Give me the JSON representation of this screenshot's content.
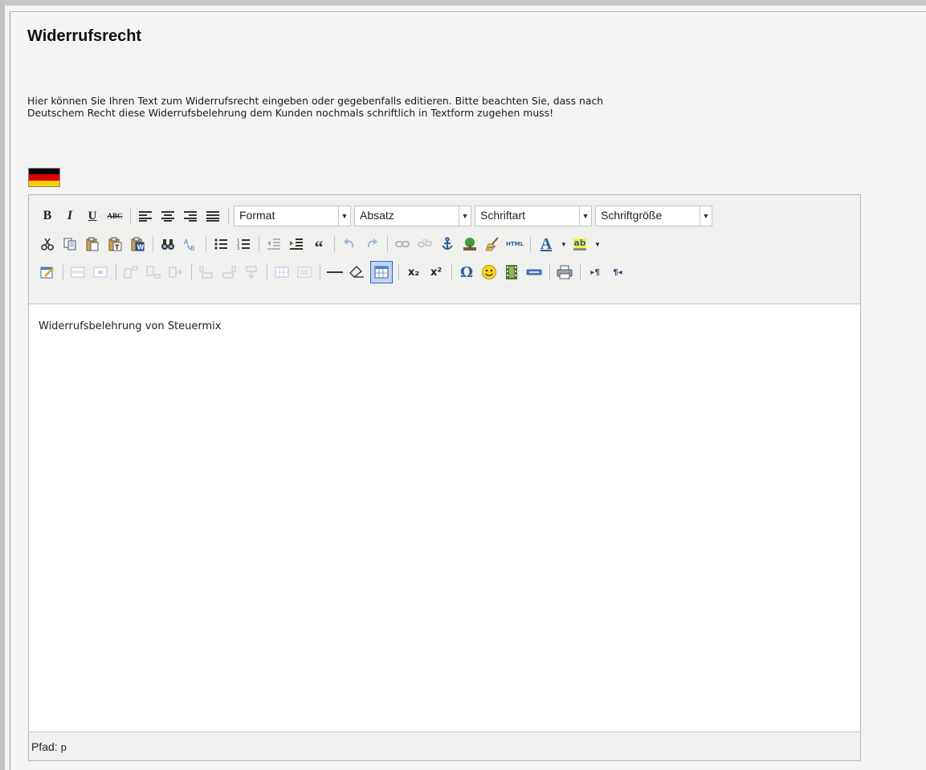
{
  "page": {
    "title": "Widerrufsrecht",
    "description_line1": "Hier können Sie Ihren Text zum Widerrufsrecht eingeben oder gegebenfalls editieren. Bitte beachten Sie, dass nach",
    "description_line2": "Deutschem Recht diese Widerrufsbelehrung dem Kunden nochmals schriftlich in Textform zugehen muss!"
  },
  "flag": {
    "name": "germany-flag-icon",
    "colors": [
      "#000000",
      "#dd0000",
      "#ffce00"
    ]
  },
  "toolbar": {
    "row1": {
      "bold": "B",
      "italic": "I",
      "underline": "U",
      "strikethrough": "ABC",
      "selects": [
        {
          "name": "format-select",
          "value": "Format"
        },
        {
          "name": "paragraph-select",
          "value": "Absatz"
        },
        {
          "name": "font-family-select",
          "value": "Schriftart"
        },
        {
          "name": "font-size-select",
          "value": "Schriftgröße"
        }
      ]
    },
    "row2": {
      "html": "HTML",
      "quote": "“",
      "font_color_letter": "A",
      "highlight_letters": "ab"
    },
    "row3": {
      "subscript": "x₂",
      "superscript": "x²",
      "omega": "Ω",
      "ltr": "▸¶",
      "rtl": "¶◂"
    }
  },
  "editor": {
    "content": "Widerrufsbelehrung von Steuermix",
    "status_label": "Pfad:",
    "status_path": "p"
  },
  "colors": {
    "accent_red": "#dd0000",
    "accent_blue": "#316ac5"
  }
}
